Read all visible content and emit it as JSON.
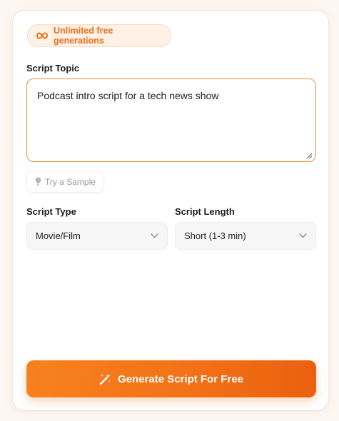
{
  "badge": {
    "icon": "infinity-icon",
    "text": "Unlimited free generations"
  },
  "topic": {
    "label": "Script Topic",
    "value": "Podcast intro script for a tech news show"
  },
  "sample": {
    "icon": "lightbulb-icon",
    "label": "Try a Sample"
  },
  "script_type": {
    "label": "Script Type",
    "value": "Movie/Film"
  },
  "script_length": {
    "label": "Script Length",
    "value": "Short (1-3 min)"
  },
  "generate": {
    "icon": "magic-wand-icon",
    "label": "Generate Script For Free"
  },
  "colors": {
    "accent": "#f37217",
    "badge_bg": "#fff1e6",
    "page_bg": "#fdf6f1"
  }
}
